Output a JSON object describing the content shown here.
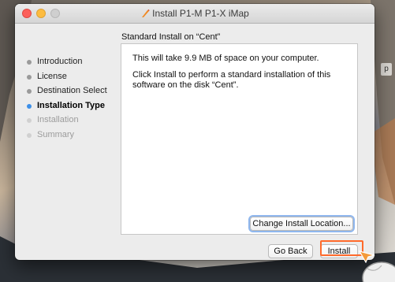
{
  "window": {
    "title": "Install P1-M P1-X iMap",
    "title_icon": "installer-icon"
  },
  "subtitle": "Standard Install on “Cent”",
  "sidebar": {
    "items": [
      {
        "label": "Introduction",
        "state": "done"
      },
      {
        "label": "License",
        "state": "done"
      },
      {
        "label": "Destination Select",
        "state": "done"
      },
      {
        "label": "Installation Type",
        "state": "active"
      },
      {
        "label": "Installation",
        "state": "pending"
      },
      {
        "label": "Summary",
        "state": "pending"
      }
    ]
  },
  "content": {
    "line1": "This will take 9.9 MB of space on your computer.",
    "line2": "Click Install to perform a standard installation of this software on the disk “Cent”."
  },
  "buttons": {
    "change_location": "Change Install Location...",
    "go_back": "Go Back",
    "install": "Install"
  },
  "desktop": {
    "peek_text": "p"
  },
  "colors": {
    "accent": "#3d8fe8",
    "highlight": "#ff6a2b",
    "close": "#fc605b",
    "minimize": "#fdbc40"
  }
}
